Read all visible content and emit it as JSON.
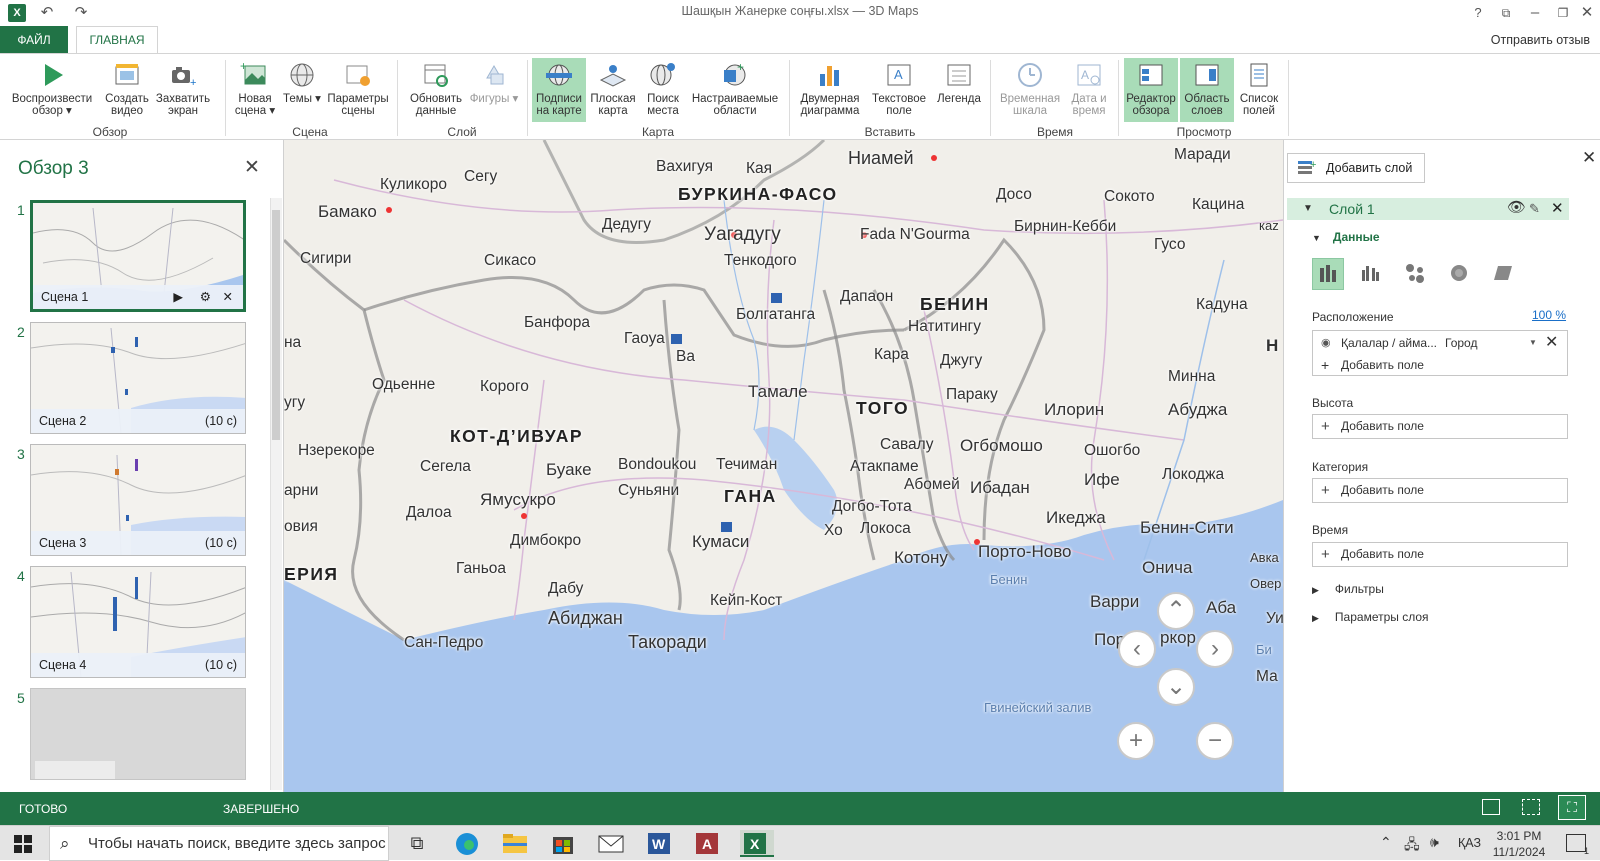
{
  "window": {
    "title": "Шашқын Жанерке соңғы.xlsx — 3D Maps"
  },
  "tabs": {
    "file": "ФАЙЛ",
    "home": "ГЛАВНАЯ",
    "feedback": "Отправить отзыв"
  },
  "ribbon": {
    "buttons": {
      "play_tour": "Воспроизвести обзор ▾",
      "create_video": "Создать видео",
      "capture_screen": "Захватить экран",
      "new_scene": "Новая сцена ▾",
      "themes": "Темы ▾",
      "scene_options": "Параметры сцены",
      "refresh_data": "Обновить данные",
      "shapes": "Фигуры ▾",
      "map_labels": "Подписи на карте",
      "flat_map": "Плоская карта",
      "find_location": "Поиск места",
      "custom_regions": "Настраиваемые области",
      "chart_2d": "Двумерная диаграмма",
      "text_box": "Текстовое поле",
      "legend": "Легенда",
      "timeline": "Временная шкала",
      "date_time": "Дата и время",
      "tour_editor": "Редактор обзора",
      "layer_pane": "Область слоев",
      "field_list": "Список полей"
    },
    "groups": {
      "tour": "Обзор",
      "scene": "Сцена",
      "layer": "Слой",
      "map": "Карта",
      "insert": "Вставить",
      "time": "Время",
      "view": "Просмотр"
    }
  },
  "tour_pane": {
    "title": "Обзор 3",
    "scenes": [
      {
        "number": "1",
        "name": "Сцена 1",
        "duration": ""
      },
      {
        "number": "2",
        "name": "Сцена 2",
        "duration": "(10 с)"
      },
      {
        "number": "3",
        "name": "Сцена 3",
        "duration": "(10 с)"
      },
      {
        "number": "4",
        "name": "Сцена 4",
        "duration": "(10 с)"
      },
      {
        "number": "5",
        "name": "",
        "duration": ""
      }
    ]
  },
  "map": {
    "countries": {
      "burkina_faso": "БУРКИНА-ФАСО",
      "benin": "БЕНИН",
      "togo": "ТОГО",
      "ghana": "ГАНА",
      "cote_divoire": "КОТ-Д’ИВУАР",
      "liberia": "ЕРИЯ"
    },
    "water": {
      "benin_bight": "Бенин",
      "gulf_of_guinea": "Гвинейский залив"
    },
    "cities": {
      "ouahigouya": "Вахигуя",
      "kaya": "Кая",
      "niamey": "Ниамей",
      "maradi": "Маради",
      "koulikoro": "Куликоро",
      "segou": "Сегу",
      "bamako": "Бамако",
      "dedougou": "Дедугу",
      "ouagadougou": "Уагадугу",
      "fada": "Fada N'Gourma",
      "dosso": "Досо",
      "sokoto": "Сокото",
      "katsina": "Кацина",
      "birnin_kebbi": "Бирнин-Кебби",
      "guso": "Гусо",
      "siguiri": "Сигири",
      "sikasso": "Сикасо",
      "tenkodogo": "Тенкодого",
      "dapaong": "Дапаон",
      "kaduna": "Кадуна",
      "banfora": "Банфора",
      "gaoua": "Гаоуа",
      "wa": "Ва",
      "bolgatanga": "Болгатанга",
      "natitingou": "Натитингу",
      "kara": "Кара",
      "djougou": "Джугу",
      "odienne": "Одьенне",
      "korhogo": "Корого",
      "tamale": "Тамале",
      "parakou": "Параку",
      "minna": "Минна",
      "ilorin": "Илорин",
      "abuja": "Абуджа",
      "nzerekore": "Нзерекоре",
      "seguela": "Сегела",
      "bouake": "Буаке",
      "bondoukou": "Bondoukou",
      "techiman": "Течиман",
      "savalou": "Савалу",
      "ogbomosho": "Огбомошо",
      "oshogbo": "Ошогбо",
      "atakpame": "Атакпаме",
      "abomey": "Абомей",
      "ife": "Ифе",
      "lokoja": "Локоджа",
      "sunyani": "Суньяни",
      "yamoussoukro": "Ямусукро",
      "ibadan": "Ибадан",
      "daloa": "Далоа",
      "dogbo": "Догбо-Тота",
      "lokossa": "Локоса",
      "ikeja": "Икеджа",
      "benin_city": "Бенин-Сити",
      "kumasi": "Кумаси",
      "dimbokro": "Димбокро",
      "kho": "Хо",
      "kotonou": "Котону",
      "porto_novo": "Порто-Ново",
      "ganhoa": "Ганьоа",
      "onicha": "Онича",
      "awka": "Авка",
      "dabou": "Дабу",
      "cape_coast": "Кейп-Кост",
      "warri": "Варри",
      "owerri": "Овер",
      "aba": "Аба",
      "abidjan": "Абиджан",
      "san_pedro": "Сан-Педро",
      "takoradi": "Такоради",
      "port": "Пор",
      "harcourt": "ркор",
      "bi": "Би",
      "ma": "Ма",
      "kaz": "каz",
      "na": "на",
      "ugu": "угу",
      "barni": "арни",
      "ovia": "овия",
      "ui": "Уи",
      "n_edge": "Н"
    }
  },
  "layer_pane": {
    "add_layer": "Добавить слой",
    "layer_name": "Слой 1",
    "data_section": "Данные",
    "location_label": "Расположение",
    "location_percent": "100 %",
    "location_field": "Қалалар / айма...",
    "location_type": "Город",
    "add_field": "Добавить поле",
    "height_label": "Высота",
    "category_label": "Категория",
    "time_label": "Время",
    "filters": "Фильтры",
    "layer_options": "Параметры слоя"
  },
  "status": {
    "ready": "ГОТОВО",
    "completed": "ЗАВЕРШЕНО"
  },
  "taskbar": {
    "search_placeholder": "Чтобы начать поиск, введите здесь запрос",
    "language": "ҚАЗ",
    "time": "3:01 PM",
    "date": "11/1/2024",
    "notifications": "1"
  },
  "colors": {
    "accent": "#217346",
    "selected": "#a9dcb8",
    "water": "#a9c6ee",
    "marker": "#2e62b0"
  }
}
